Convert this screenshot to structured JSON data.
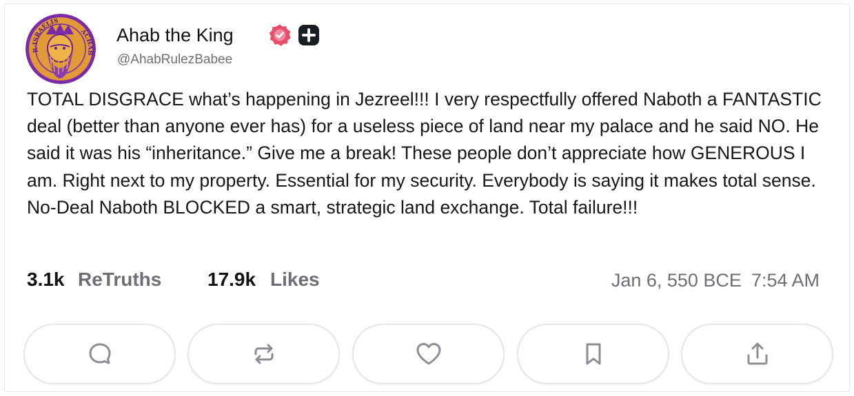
{
  "author": {
    "display_name": "Ahab the King",
    "handle": "@AhabRulezBabee",
    "avatar_icon": "royal-coin-portrait-icon",
    "avatar_text": "R·ISRAELIS ACHAB",
    "verified_badge_color": "#ea4d6a",
    "plus_badge_color": "#1a1d24"
  },
  "post": {
    "text": "TOTAL DISGRACE what’s happening in Jezreel!!! I very respectfully offered Naboth a FANTASTIC deal (better than anyone ever has) for a useless piece of land near my palace and he said NO. He said it was his “inheritance.” Give me a break! These people don’t appreciate how GENEROUS I am. Right next to my property. Essential for my security. Everybody is saying it makes total sense. No-Deal Naboth BLOCKED a smart, strategic land exchange. Total failure!!!"
  },
  "stats": {
    "retruths_count": "3.1k",
    "retruths_label": "ReTruths",
    "likes_count": "17.9k",
    "likes_label": "Likes"
  },
  "timestamp": {
    "date": "Jan 6, 550 BCE",
    "time": "7:54 AM"
  },
  "actions": [
    {
      "name": "reply",
      "icon": "comment-bubble-icon"
    },
    {
      "name": "retruth",
      "icon": "repost-arrows-icon"
    },
    {
      "name": "like",
      "icon": "heart-icon"
    },
    {
      "name": "bookmark",
      "icon": "bookmark-icon"
    },
    {
      "name": "share",
      "icon": "share-upload-icon"
    }
  ],
  "colors": {
    "text_primary": "#14161a",
    "text_muted": "#6e6e76",
    "border": "#e3e6ea",
    "icon_gray": "#8a8d94"
  }
}
